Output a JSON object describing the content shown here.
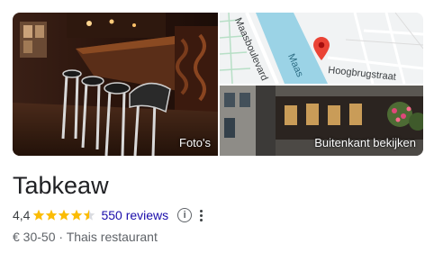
{
  "place": {
    "name": "Tabkeaw",
    "rating": "4,4",
    "stars": 4.5,
    "reviews": "550 reviews",
    "price": "€ 30-50",
    "separator": "·",
    "category": "Thais restaurant"
  },
  "photos": {
    "main_caption": "Foto's",
    "front_caption": "Buitenkant bekijken"
  },
  "map": {
    "street_1": "Maasboulevard",
    "water_label": "Maas",
    "street_2": "Hoogbrugstraat"
  },
  "colors": {
    "star": "#fbbc04",
    "link": "#1a0dab",
    "water": "#9bd3e6",
    "pin": "#ea4335"
  },
  "icons": {
    "info": "info-circle-icon",
    "more": "more-vertical-icon"
  }
}
